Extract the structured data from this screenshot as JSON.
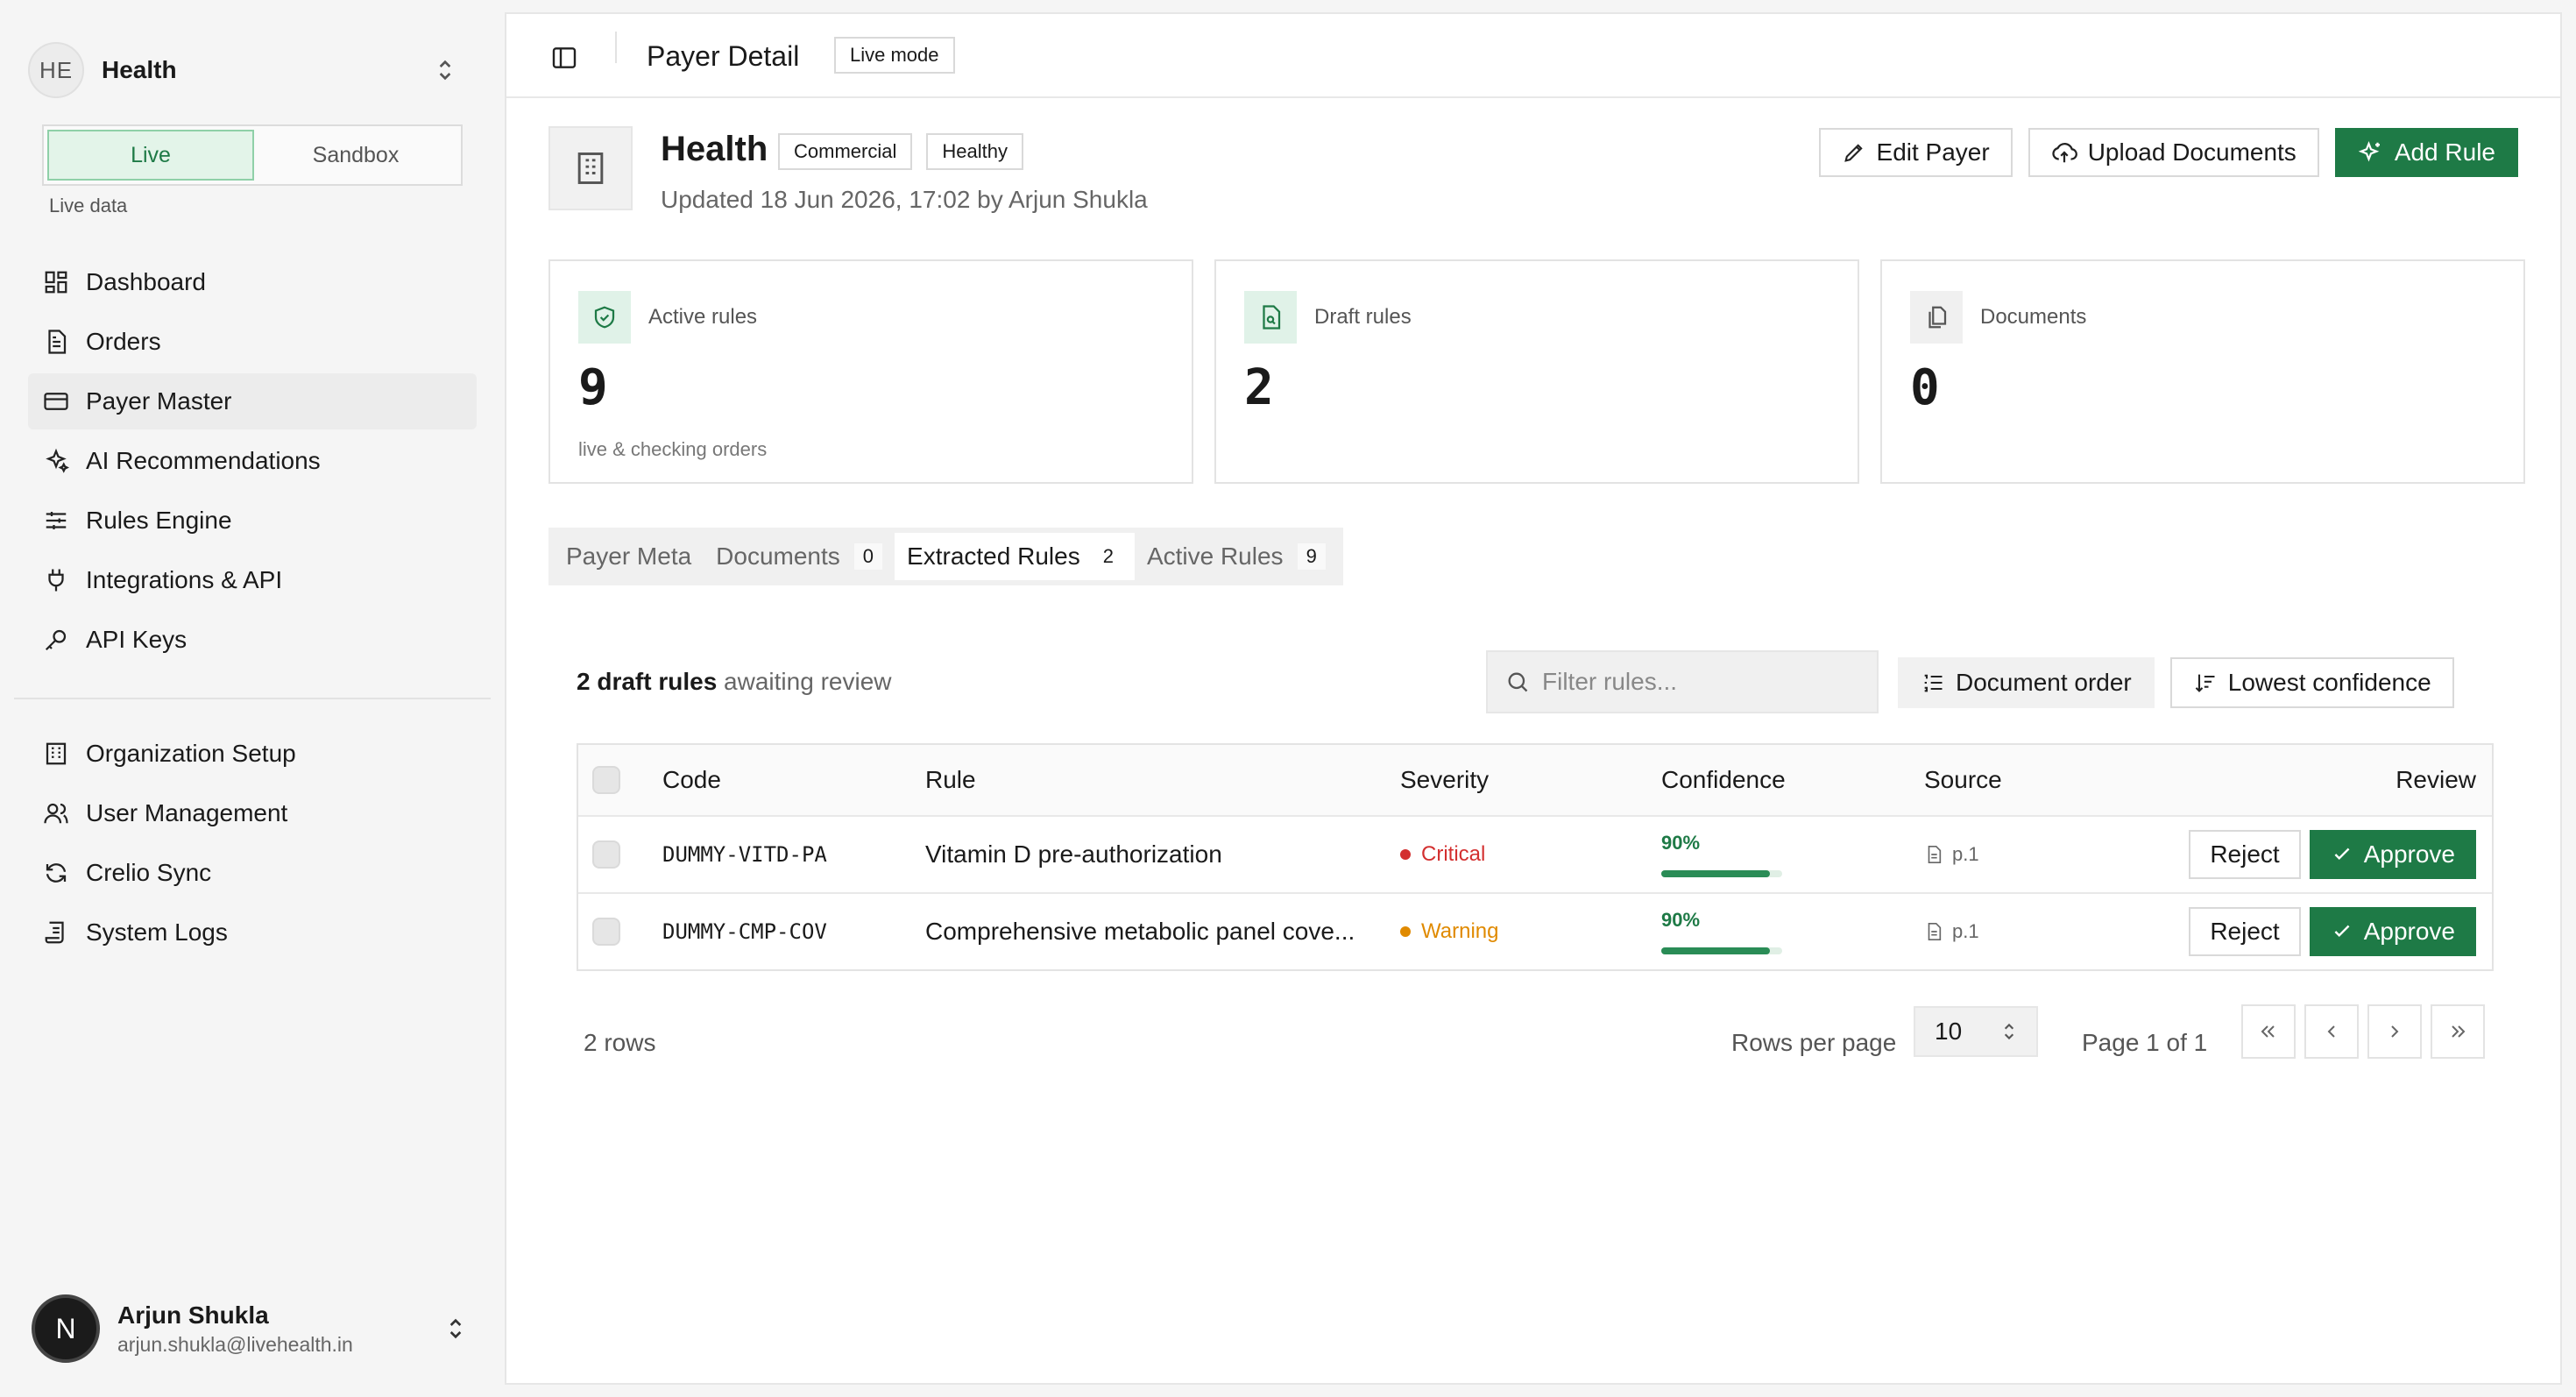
{
  "org": {
    "initials": "HE",
    "name": "Health"
  },
  "mode": {
    "live": "Live",
    "sandbox": "Sandbox",
    "caption": "Live data"
  },
  "nav": {
    "primary": [
      {
        "label": "Dashboard",
        "icon": "dashboard-icon"
      },
      {
        "label": "Orders",
        "icon": "document-icon"
      },
      {
        "label": "Payer Master",
        "icon": "card-icon",
        "active": true
      },
      {
        "label": "AI Recommendations",
        "icon": "sparkles-icon"
      },
      {
        "label": "Rules Engine",
        "icon": "sliders-icon"
      },
      {
        "label": "Integrations & API",
        "icon": "plug-icon"
      },
      {
        "label": "API Keys",
        "icon": "key-icon"
      }
    ],
    "secondary": [
      {
        "label": "Organization Setup",
        "icon": "building-icon"
      },
      {
        "label": "User Management",
        "icon": "users-icon"
      },
      {
        "label": "Crelio Sync",
        "icon": "refresh-icon"
      },
      {
        "label": "System Logs",
        "icon": "scroll-icon"
      }
    ]
  },
  "user": {
    "initial": "N",
    "name": "Arjun Shukla",
    "email": "arjun.shukla@livehealth.in"
  },
  "topbar": {
    "title": "Payer Detail",
    "mode_badge": "Live mode"
  },
  "payer": {
    "name": "Health",
    "tags": [
      "Commercial",
      "Healthy"
    ],
    "updated": "Updated 18 Jun 2026, 17:02 by Arjun Shukla"
  },
  "actions": {
    "edit": "Edit Payer",
    "upload": "Upload Documents",
    "add": "Add Rule"
  },
  "stats": [
    {
      "label": "Active rules",
      "value": "9",
      "sub": "live & checking orders",
      "icon": "shield-check-icon"
    },
    {
      "label": "Draft rules",
      "value": "2",
      "sub": "",
      "icon": "file-search-icon"
    },
    {
      "label": "Documents",
      "value": "0",
      "sub": "",
      "icon": "files-icon"
    }
  ],
  "tabs": [
    {
      "label": "Payer Meta",
      "count": ""
    },
    {
      "label": "Documents",
      "count": "0"
    },
    {
      "label": "Extracted Rules",
      "count": "2",
      "active": true
    },
    {
      "label": "Active Rules",
      "count": "9"
    }
  ],
  "toolbar": {
    "summary_bold": "2 draft rules",
    "summary_rest": " awaiting review",
    "search_placeholder": "Filter rules...",
    "order_btn": "Document order",
    "confidence_btn": "Lowest confidence"
  },
  "table": {
    "headers": {
      "code": "Code",
      "rule": "Rule",
      "severity": "Severity",
      "confidence": "Confidence",
      "source": "Source",
      "review": "Review"
    },
    "rows": [
      {
        "code": "DUMMY-VITD-PA",
        "rule": "Vitamin D pre-authorization",
        "severity": "Critical",
        "severity_color": "#d32f2f",
        "confidence": "90%",
        "confidence_value": 0.9,
        "source": "p.1",
        "reject": "Reject",
        "approve": "Approve"
      },
      {
        "code": "DUMMY-CMP-COV",
        "rule": "Comprehensive metabolic panel cove...",
        "severity": "Warning",
        "severity_color": "#e08a00",
        "confidence": "90%",
        "confidence_value": 0.9,
        "source": "p.1",
        "reject": "Reject",
        "approve": "Approve"
      }
    ]
  },
  "pagination": {
    "rows": "2 rows",
    "rpp_label": "Rows per page",
    "rpp_value": "10",
    "page": "Page 1 of 1"
  },
  "colors": {
    "accent": "#1e7a46",
    "critical": "#d32f2f",
    "warning": "#e08a00"
  }
}
